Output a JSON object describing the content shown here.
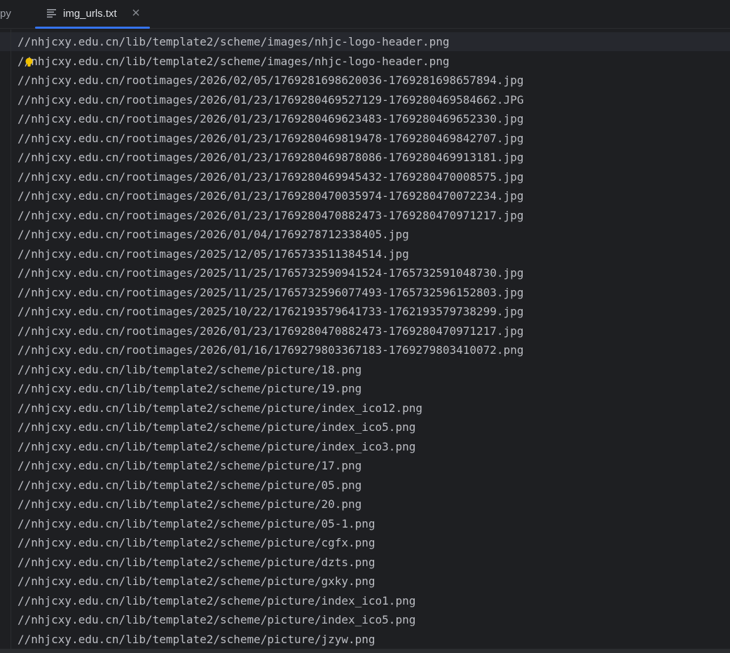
{
  "tabs": {
    "partial_label": "py",
    "active": {
      "label": "img_urls.txt",
      "icon": "text-file-icon",
      "close_icon": "close-icon"
    }
  },
  "colors": {
    "accent": "#3574f0",
    "background": "#1e1f22",
    "text": "#bcbec4",
    "bulb": "#f0c000"
  },
  "lines": [
    "//nhjcxy.edu.cn/lib/template2/scheme/images/nhjc-logo-header.png",
    "//nhjcxy.edu.cn/lib/template2/scheme/images/nhjc-logo-header.png",
    "//nhjcxy.edu.cn/rootimages/2026/02/05/1769281698620036-1769281698657894.jpg",
    "//nhjcxy.edu.cn/rootimages/2026/01/23/1769280469527129-1769280469584662.JPG",
    "//nhjcxy.edu.cn/rootimages/2026/01/23/1769280469623483-1769280469652330.jpg",
    "//nhjcxy.edu.cn/rootimages/2026/01/23/1769280469819478-1769280469842707.jpg",
    "//nhjcxy.edu.cn/rootimages/2026/01/23/1769280469878086-1769280469913181.jpg",
    "//nhjcxy.edu.cn/rootimages/2026/01/23/1769280469945432-1769280470008575.jpg",
    "//nhjcxy.edu.cn/rootimages/2026/01/23/1769280470035974-1769280470072234.jpg",
    "//nhjcxy.edu.cn/rootimages/2026/01/23/1769280470882473-1769280470971217.jpg",
    "//nhjcxy.edu.cn/rootimages/2026/01/04/1769278712338405.jpg",
    "//nhjcxy.edu.cn/rootimages/2025/12/05/1765733511384514.jpg",
    "//nhjcxy.edu.cn/rootimages/2025/11/25/1765732590941524-1765732591048730.jpg",
    "//nhjcxy.edu.cn/rootimages/2025/11/25/1765732596077493-1765732596152803.jpg",
    "//nhjcxy.edu.cn/rootimages/2025/10/22/1762193579641733-1762193579738299.jpg",
    "//nhjcxy.edu.cn/rootimages/2026/01/23/1769280470882473-1769280470971217.jpg",
    "//nhjcxy.edu.cn/rootimages/2026/01/16/1769279803367183-1769279803410072.png",
    "//nhjcxy.edu.cn/lib/template2/scheme/picture/18.png",
    "//nhjcxy.edu.cn/lib/template2/scheme/picture/19.png",
    "//nhjcxy.edu.cn/lib/template2/scheme/picture/index_ico12.png",
    "//nhjcxy.edu.cn/lib/template2/scheme/picture/index_ico5.png",
    "//nhjcxy.edu.cn/lib/template2/scheme/picture/index_ico3.png",
    "//nhjcxy.edu.cn/lib/template2/scheme/picture/17.png",
    "//nhjcxy.edu.cn/lib/template2/scheme/picture/05.png",
    "//nhjcxy.edu.cn/lib/template2/scheme/picture/20.png",
    "//nhjcxy.edu.cn/lib/template2/scheme/picture/05-1.png",
    "//nhjcxy.edu.cn/lib/template2/scheme/picture/cgfx.png",
    "//nhjcxy.edu.cn/lib/template2/scheme/picture/dzts.png",
    "//nhjcxy.edu.cn/lib/template2/scheme/picture/gxky.png",
    "//nhjcxy.edu.cn/lib/template2/scheme/picture/index_ico1.png",
    "//nhjcxy.edu.cn/lib/template2/scheme/picture/index_ico5.png",
    "//nhjcxy.edu.cn/lib/template2/scheme/picture/jzyw.png"
  ],
  "intention_bulb_icon": "lightbulb-icon"
}
